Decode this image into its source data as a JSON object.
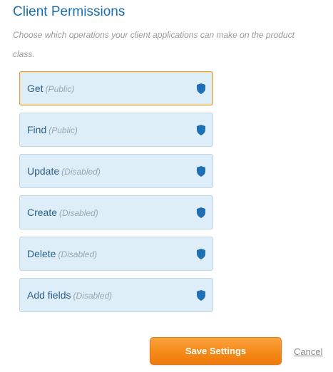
{
  "header": {
    "title": "Client Permissions",
    "subtitle": "Choose which operations your client applications can make on the product class."
  },
  "permissions": [
    {
      "name": "Get",
      "status": "(Public)",
      "selected": true,
      "icon": "shield-icon"
    },
    {
      "name": "Find",
      "status": "(Public)",
      "selected": false,
      "icon": "shield-icon"
    },
    {
      "name": "Update",
      "status": "(Disabled)",
      "selected": false,
      "icon": "shield-icon"
    },
    {
      "name": "Create",
      "status": "(Disabled)",
      "selected": false,
      "icon": "shield-icon"
    },
    {
      "name": "Delete",
      "status": "(Disabled)",
      "selected": false,
      "icon": "shield-icon"
    },
    {
      "name": "Add fields",
      "status": "(Disabled)",
      "selected": false,
      "icon": "shield-icon"
    }
  ],
  "actions": {
    "save_label": "Save Settings",
    "cancel_label": "Cancel"
  },
  "colors": {
    "title": "#1a6fae",
    "item_background": "#ddeef8",
    "item_border": "#c3d6e3",
    "selected_border": "#e0a543",
    "shield": "#1f6fb5",
    "save_button": "#f58a18"
  }
}
